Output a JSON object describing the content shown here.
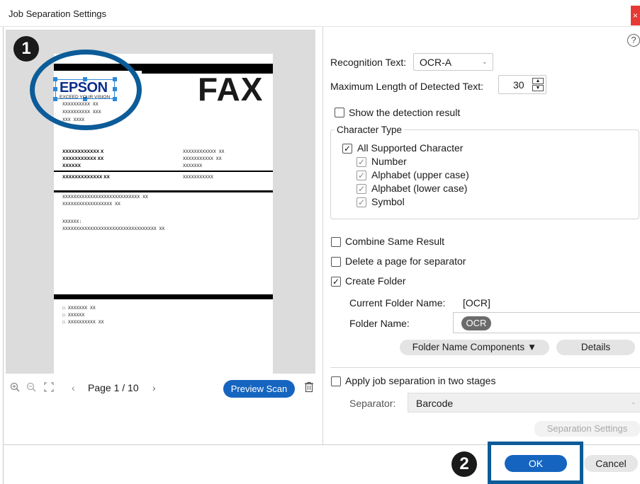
{
  "window": {
    "title": "Job Separation Settings",
    "close_label": "×"
  },
  "preview": {
    "document": {
      "fax_title": "FAX",
      "logo_text": "EPSON",
      "logo_tagline": "EXCEED YOUR VISION",
      "sender_lines": [
        "XXXXXXXXXX XX",
        "XXXXXXXXXX XXX",
        "XXX XXXX"
      ],
      "left_block": [
        "XXXXXXXXXXXX X",
        "XXXXXXXXXXX XX",
        "XXXXXX",
        "XXXXXXXXXXXXX XX"
      ],
      "right_block": [
        "XXXXXXXXXXXX XX",
        "XXXXXXXXXXX XX",
        "XXXXXXX",
        "XXXXXXXXXXX"
      ],
      "body_lines": [
        "XXXXXXXXXXXXXXXXXXXXXXXXXXXX XX",
        "XXXXXXXXXXXXXXXXXX XX"
      ],
      "label_line": "XXXXXX:",
      "body_line2": "XXXXXXXXXXXXXXXXXXXXXXXXXXXXXXXXXX XX",
      "checkbox_lines": [
        "☐ XXXXXXX XX",
        "☐ XXXXXX",
        "☐ XXXXXXXXXX XX"
      ]
    },
    "callout_1": "1",
    "page_prefix": "Page",
    "page_value": "1 / 10",
    "preview_scan_label": "Preview Scan",
    "icons": [
      "zoom-in-icon",
      "zoom-out-icon",
      "fit-page-icon",
      "prev-page-icon",
      "next-page-icon",
      "trash-icon"
    ]
  },
  "settings": {
    "help_icon": "?",
    "recognition_text_label": "Recognition Text:",
    "recognition_text_value": "OCR-A",
    "max_length_label": "Maximum Length of Detected Text:",
    "max_length_value": "30",
    "show_detection_label": "Show the detection result",
    "show_detection_checked": false,
    "character_type_title": "Character Type",
    "all_supported_label": "All Supported Character",
    "all_supported_checked": true,
    "char_options": [
      {
        "label": "Number",
        "checked": true
      },
      {
        "label": "Alphabet (upper case)",
        "checked": true
      },
      {
        "label": "Alphabet (lower case)",
        "checked": true
      },
      {
        "label": "Symbol",
        "checked": true
      }
    ],
    "combine_label": "Combine Same Result",
    "combine_checked": false,
    "delete_page_label": "Delete a page for separator",
    "delete_page_checked": false,
    "create_folder_label": "Create Folder",
    "create_folder_checked": true,
    "current_folder_label": "Current Folder Name:",
    "current_folder_value": "[OCR]",
    "folder_name_label": "Folder Name:",
    "folder_name_chip": "OCR",
    "folder_name_components_label": "Folder Name Components ▼",
    "details_label": "Details",
    "two_stage_label": "Apply job separation in two stages",
    "two_stage_checked": false,
    "separator_label": "Separator:",
    "separator_value": "Barcode",
    "separation_settings_label": "Separation Settings"
  },
  "footer": {
    "callout_2": "2",
    "ok_label": "OK",
    "cancel_label": "Cancel"
  },
  "colors": {
    "accent": "#1565c0",
    "callout": "#0b5c98",
    "close": "#e53935"
  }
}
